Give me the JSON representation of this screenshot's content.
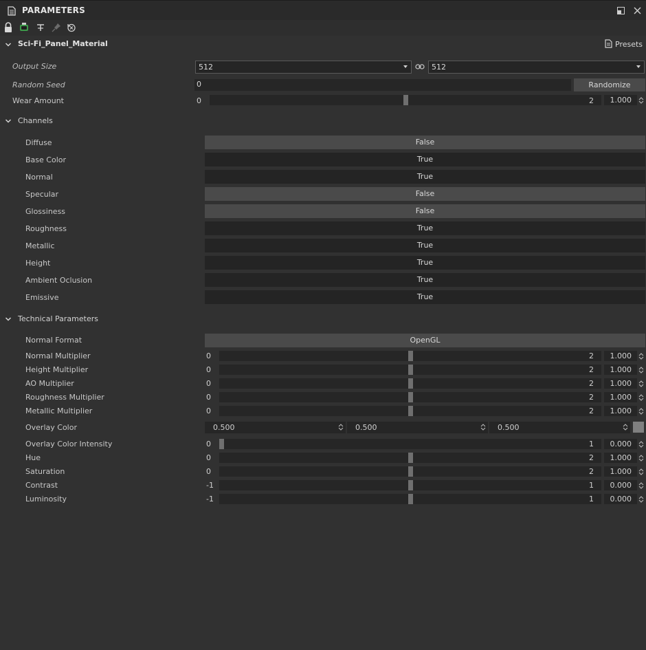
{
  "panel": {
    "title": "PARAMETERS",
    "icon": "document-icon",
    "window_icons": [
      "undock-icon",
      "close-icon"
    ]
  },
  "toolbar": {
    "icons": [
      "lock-icon",
      "inherit-icon",
      "tweak-icon",
      "pin-icon",
      "reset-icon"
    ]
  },
  "material": {
    "name": "Sci-Fi_Panel_Material",
    "presets_label": "Presets"
  },
  "general": {
    "output_size": {
      "label": "Output Size",
      "width": "512",
      "height": "512"
    },
    "random_seed": {
      "label": "Random Seed",
      "value": "0",
      "button": "Randomize"
    },
    "wear_amount": {
      "label": "Wear Amount",
      "min": "0",
      "max": "2",
      "value": "1.000",
      "fraction": 0.5
    }
  },
  "channels": {
    "title": "Channels",
    "items": [
      {
        "label": "Diffuse",
        "value": "False"
      },
      {
        "label": "Base Color",
        "value": "True"
      },
      {
        "label": "Normal",
        "value": "True"
      },
      {
        "label": "Specular",
        "value": "False"
      },
      {
        "label": "Glossiness",
        "value": "False"
      },
      {
        "label": "Roughness",
        "value": "True"
      },
      {
        "label": "Metallic",
        "value": "True"
      },
      {
        "label": "Height",
        "value": "True"
      },
      {
        "label": "Ambient Oclusion",
        "value": "True"
      },
      {
        "label": "Emissive",
        "value": "True"
      }
    ]
  },
  "technical": {
    "title": "Technical Parameters",
    "normal_format": {
      "label": "Normal Format",
      "value": "OpenGL"
    },
    "sliders_a": [
      {
        "label": "Normal Multiplier",
        "min": "0",
        "max": "2",
        "value": "1.000",
        "fraction": 0.5
      },
      {
        "label": "Height Multiplier",
        "min": "0",
        "max": "2",
        "value": "1.000",
        "fraction": 0.5
      },
      {
        "label": "AO Multiplier",
        "min": "0",
        "max": "2",
        "value": "1.000",
        "fraction": 0.5
      },
      {
        "label": "Roughness Multiplier",
        "min": "0",
        "max": "2",
        "value": "1.000",
        "fraction": 0.5
      },
      {
        "label": "Metallic Multiplier",
        "min": "0",
        "max": "2",
        "value": "1.000",
        "fraction": 0.5
      }
    ],
    "overlay_color": {
      "label": "Overlay Color",
      "r": "0.500",
      "g": "0.500",
      "b": "0.500",
      "swatch": "#808080"
    },
    "sliders_b": [
      {
        "label": "Overlay Color Intensity",
        "min": "0",
        "max": "1",
        "value": "0.000",
        "fraction": 0.0
      },
      {
        "label": "Hue",
        "min": "0",
        "max": "2",
        "value": "1.000",
        "fraction": 0.5
      },
      {
        "label": "Saturation",
        "min": "0",
        "max": "2",
        "value": "1.000",
        "fraction": 0.5
      },
      {
        "label": "Contrast",
        "min": "-1",
        "max": "1",
        "value": "0.000",
        "fraction": 0.5
      },
      {
        "label": "Luminosity",
        "min": "-1",
        "max": "1",
        "value": "0.000",
        "fraction": 0.5
      }
    ]
  },
  "colors": {
    "background": "#313131",
    "titlebar": "#2a2a2a",
    "field": "#262626",
    "button_false": "#4a4a4a",
    "button_true": "#242424",
    "knob": "#6f6f6f"
  }
}
